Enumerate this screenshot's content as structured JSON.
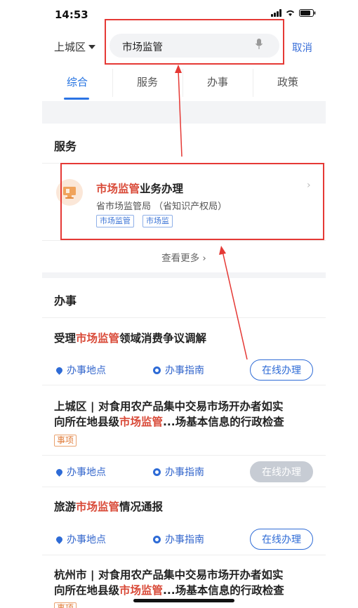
{
  "status": {
    "time": "14:53"
  },
  "header": {
    "region": "上城区",
    "search_value": "市场监管",
    "cancel": "取消"
  },
  "tabs": [
    "综合",
    "服务",
    "办事",
    "政策"
  ],
  "services": {
    "title": "服务",
    "card": {
      "title_hl": "市场监管",
      "title_rest": "业务办理",
      "subtitle": "省市场监管局 （省知识产权局）",
      "tags": [
        "市场监管",
        "市场监"
      ]
    },
    "more": "查看更多 ›"
  },
  "affairs": {
    "title": "办事",
    "location_label": "办事地点",
    "guide_label": "办事指南",
    "online_label": "在线办理",
    "matter_tag": "事项",
    "items": [
      {
        "pre": "受理",
        "hl": "市场监管",
        "post": "领域消费争议调解"
      },
      {
        "line1": "上城区 | 对食用农产品集中交易市场开办者如实",
        "pre": "向所在地县级",
        "hl": "市场监管",
        "post": "...场基本信息的行政检查"
      },
      {
        "pre": "旅游",
        "hl": "市场监管",
        "post": "情况通报"
      },
      {
        "line1": "杭州市 | 对食用农产品集中交易市场开办者如实",
        "pre": "向所在地县级",
        "hl": "市场监管",
        "post": "...场基本信息的行政检查"
      }
    ]
  },
  "colors": {
    "accent": "#2e6bd6",
    "highlight": "#d94a38",
    "annotation": "#e53935"
  }
}
